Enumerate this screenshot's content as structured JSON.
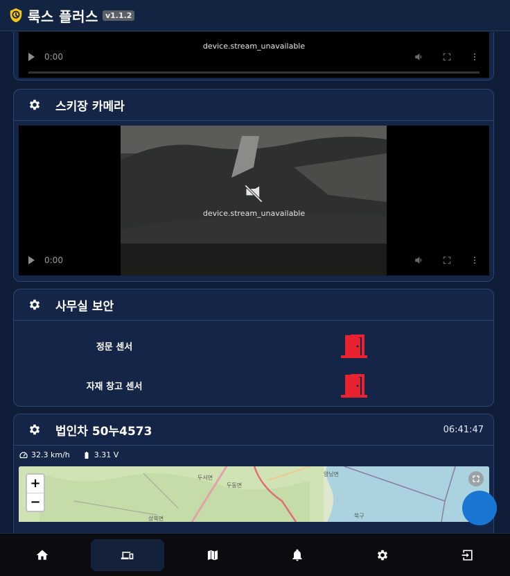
{
  "app": {
    "title": "룩스 플러스",
    "version": "v1.1.2"
  },
  "cards": {
    "top_camera": {
      "time_display": "0:00",
      "stream_message": "device.stream_unavailable"
    },
    "ski_camera": {
      "title": "스키장 카메라",
      "time_display": "0:00",
      "stream_message": "device.stream_unavailable"
    },
    "office_security": {
      "title": "사무실 보안",
      "sensors": [
        {
          "label": "정문 센서",
          "status_color": "#e8222e"
        },
        {
          "label": "자재 창고 센서",
          "status_color": "#e8222e"
        }
      ]
    },
    "vehicle": {
      "title": "법인차 50누4573",
      "time": "06:41:47",
      "speed": "32.3 km/h",
      "voltage": "3.31 V",
      "map": {
        "zoom_in": "+",
        "zoom_out": "−",
        "place_labels": [
          "두서면",
          "두동면",
          "양남면",
          "북구",
          "상북면"
        ]
      }
    }
  },
  "nav": {
    "items": [
      {
        "icon": "home-icon"
      },
      {
        "icon": "devices-icon",
        "active": true
      },
      {
        "icon": "map-icon"
      },
      {
        "icon": "bell-icon"
      },
      {
        "icon": "settings-icon"
      },
      {
        "icon": "logout-icon"
      }
    ]
  },
  "colors": {
    "background": "#0f1d38",
    "card": "#142548",
    "accent": "#1976d2",
    "alert": "#e8222e",
    "logo": "#f5c518"
  }
}
